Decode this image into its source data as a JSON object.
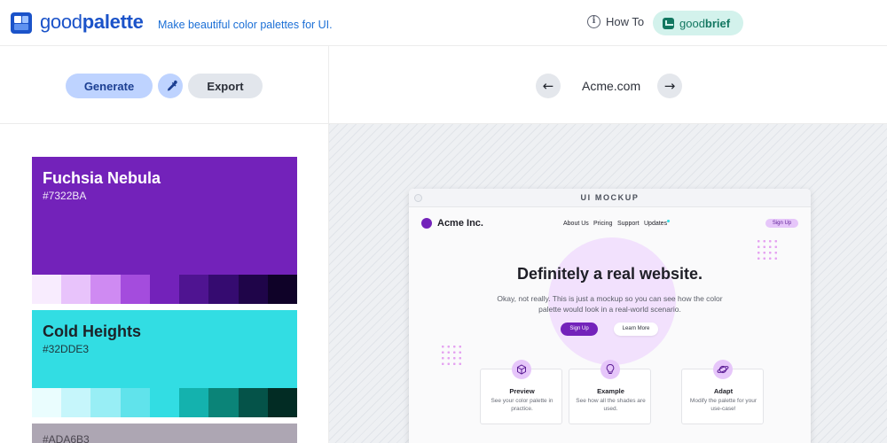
{
  "header": {
    "logo_good": "good",
    "logo_palette": "palette",
    "tagline": "Make beautiful color palettes for UI.",
    "howto_label": "How To",
    "info_glyph": "i",
    "goodbrief_good": "good",
    "goodbrief_brief": "brief"
  },
  "toolbar": {
    "generate_label": "Generate",
    "export_label": "Export",
    "picker_icon": "eyedropper-icon"
  },
  "palette": [
    {
      "name": "Fuchsia Nebula",
      "hex": "#7322BA",
      "text_color": "#ffffff",
      "shades": [
        "#f8ecfe",
        "#e8c3fb",
        "#cf8af2",
        "#a44cdd",
        "#7322ba",
        "#4f1491",
        "#350b70",
        "#1f0549",
        "#0f0228"
      ]
    },
    {
      "name": "Cold Heights",
      "hex": "#32DDE3",
      "text_color": "#1c2228",
      "shades": [
        "#eafdfe",
        "#c6f6fb",
        "#98eef5",
        "#60e3eb",
        "#32dde3",
        "#14b2ae",
        "#0b8478",
        "#055349",
        "#022c24"
      ]
    },
    {
      "hex": "#ADA6B3",
      "text_color": "#3f3b45",
      "shades": []
    }
  ],
  "preview_nav": {
    "site_name": "Acme.com",
    "prev_glyph": "←",
    "next_glyph": "→"
  },
  "mockup": {
    "window_title": "UI MOCKUP",
    "brand": "Acme Inc.",
    "nav": [
      "About Us",
      "Pricing",
      "Support",
      "Updates"
    ],
    "signup_top": "Sign Up",
    "headline": "Definitely a real website.",
    "body": "Okay, not really. This is just a mockup so you can see how the color palette would look in a real-world scenario.",
    "cta_primary": "Sign Up",
    "cta_secondary": "Learn More",
    "cards": [
      {
        "title": "Preview",
        "desc": "See your color palette in practice.",
        "icon": "cube-icon"
      },
      {
        "title": "Example",
        "desc": "See how all the shades are used.",
        "icon": "lightbulb-icon"
      },
      {
        "title": "Adapt",
        "desc": "Modify the palette for your use-case!",
        "icon": "planet-icon"
      }
    ]
  },
  "colors": {
    "brand_blue": "#1b53c9",
    "accent_purple": "#7322ba",
    "accent_cyan": "#32dde3",
    "goodbrief_bg": "#d3f2ec",
    "goodbrief_fg": "#127760"
  }
}
